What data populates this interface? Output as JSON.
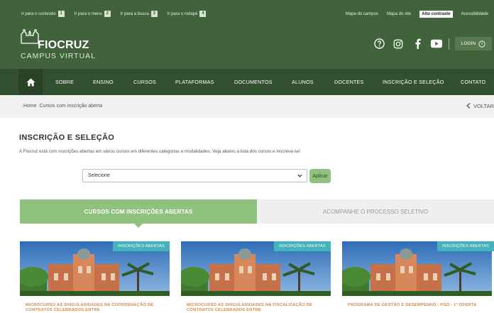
{
  "skip_links": [
    {
      "label": "Ir para o conteúdo",
      "key": "1"
    },
    {
      "label": "Ir para o menu",
      "key": "2"
    },
    {
      "label": "Ir para a busca",
      "key": "3"
    },
    {
      "label": "Ir para o rodapé",
      "key": "4"
    }
  ],
  "utility_links": {
    "campus_map": "Mapa do campus",
    "site_map": "Mapa do site",
    "high_contrast": "Alto contraste",
    "accessibility": "Acessibilidade"
  },
  "logo": {
    "name": "FIOCRUZ",
    "subtitle": "CAMPUS VIRTUAL"
  },
  "social_icons": [
    "help-icon",
    "instagram-icon",
    "facebook-icon",
    "youtube-icon"
  ],
  "login": {
    "label": "LOGIN"
  },
  "nav": {
    "home_icon": "home-icon",
    "items": [
      "SOBRE",
      "ENSINO",
      "CURSOS",
      "PLATAFORMAS",
      "DOCUMENTOS",
      "ALUNOS",
      "DOCENTES",
      "INSCRIÇÃO E SELEÇÃO",
      "CONTATO"
    ]
  },
  "breadcrumb": {
    "path": ".Home  .Cursos com inscrição aberta",
    "back": "VOLTAR"
  },
  "page": {
    "title": "INSCRIÇÃO E SELEÇÃO",
    "intro": "A Fiocruz está com inscrições abertas em vários cursos em diferentes categorias e modalidades. Veja abaixo a lista dos cursos e inscreva-se!"
  },
  "filter": {
    "select_value": "Selecione",
    "apply_label": "Aplicar"
  },
  "tabs": {
    "active": "CURSOS COM INSCRIÇÕES ABERTAS",
    "other": "ACOMPANHE O PROCESSO SELETIVO"
  },
  "cards": [
    {
      "badge": "INSCRIÇÕES ABERTAS",
      "title": "MICROCURSO AS SINGULARIDADES NA COORDENAÇÃO DE CONTRATOS CELEBRADOS ENTRE"
    },
    {
      "badge": "INSCRIÇÕES ABERTAS",
      "title": "MICROCURSO AS SINGULARIDADES NA FISCALIZAÇÃO DE CONTRATOS CELEBRADOS ENTRE"
    },
    {
      "badge": "INSCRIÇÕES ABERTAS",
      "title": "PROGRAMA DE GESTÃO E DESEMPENHO - PGD - 1ª OFERTA"
    }
  ],
  "colors": {
    "header_green": "#40633c",
    "nav_green": "#324f30",
    "accent_green": "#8fc27e",
    "badge_teal": "#45b3bd",
    "card_title_orange": "#d48a4a"
  }
}
